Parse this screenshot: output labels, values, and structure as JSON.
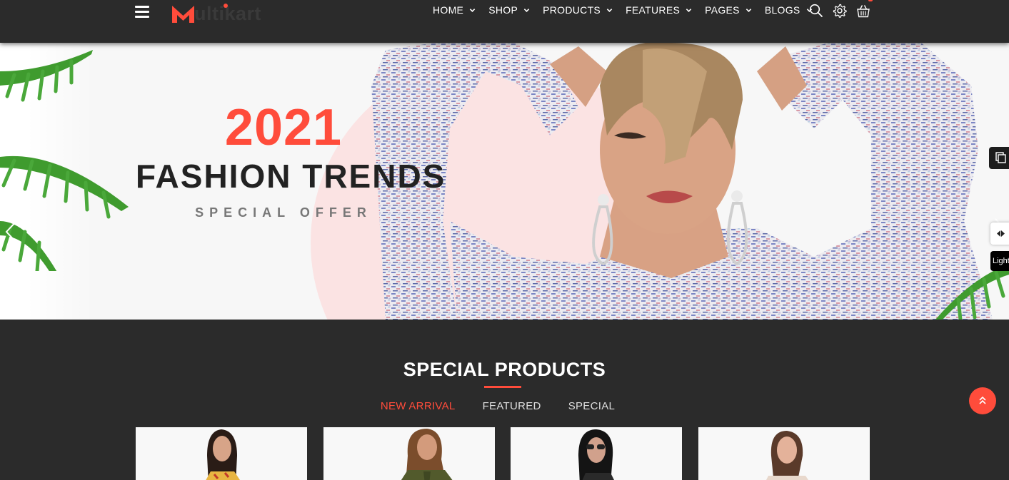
{
  "header": {
    "logo_text": "ultikart",
    "nav": [
      {
        "label": "HOME"
      },
      {
        "label": "SHOP"
      },
      {
        "label": "PRODUCTS"
      },
      {
        "label": "FEATURES"
      },
      {
        "label": "PAGES"
      },
      {
        "label": "BLOGS"
      }
    ],
    "icons": [
      "search-icon",
      "gear-icon",
      "cart-icon"
    ]
  },
  "hero": {
    "year": "2021",
    "title": "FASHION TRENDS",
    "subtitle": "SPECIAL OFFER"
  },
  "side_widgets": {
    "light_label": "Light"
  },
  "section": {
    "title": "SPECIAL PRODUCTS",
    "tabs": [
      {
        "label": "NEW ARRIVAL",
        "active": true
      },
      {
        "label": "FEATURED",
        "active": false
      },
      {
        "label": "SPECIAL",
        "active": false
      }
    ]
  },
  "colors": {
    "accent": "#ff4c3b",
    "background": "#2b2b2b"
  }
}
